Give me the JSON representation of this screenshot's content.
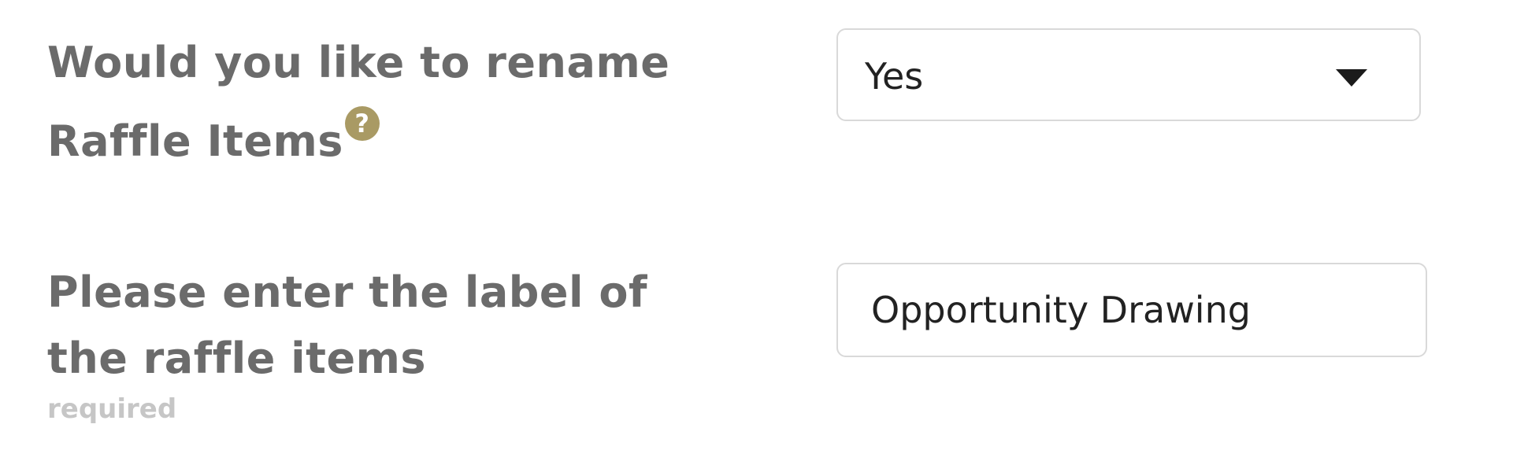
{
  "form": {
    "rename_question": {
      "label": "Would you like to rename Raffle Items",
      "help_icon": "question-mark-icon",
      "help_glyph": "?",
      "selected_value": "Yes"
    },
    "label_question": {
      "label": "Please enter the label of the raffle items",
      "hint": "required",
      "input_value": "Opportunity Drawing"
    },
    "colors": {
      "label_text": "#6b6b6b",
      "help_icon_bg": "#a99a64",
      "hint_text": "#c6c6c6",
      "field_border": "#d9d9d9"
    }
  }
}
